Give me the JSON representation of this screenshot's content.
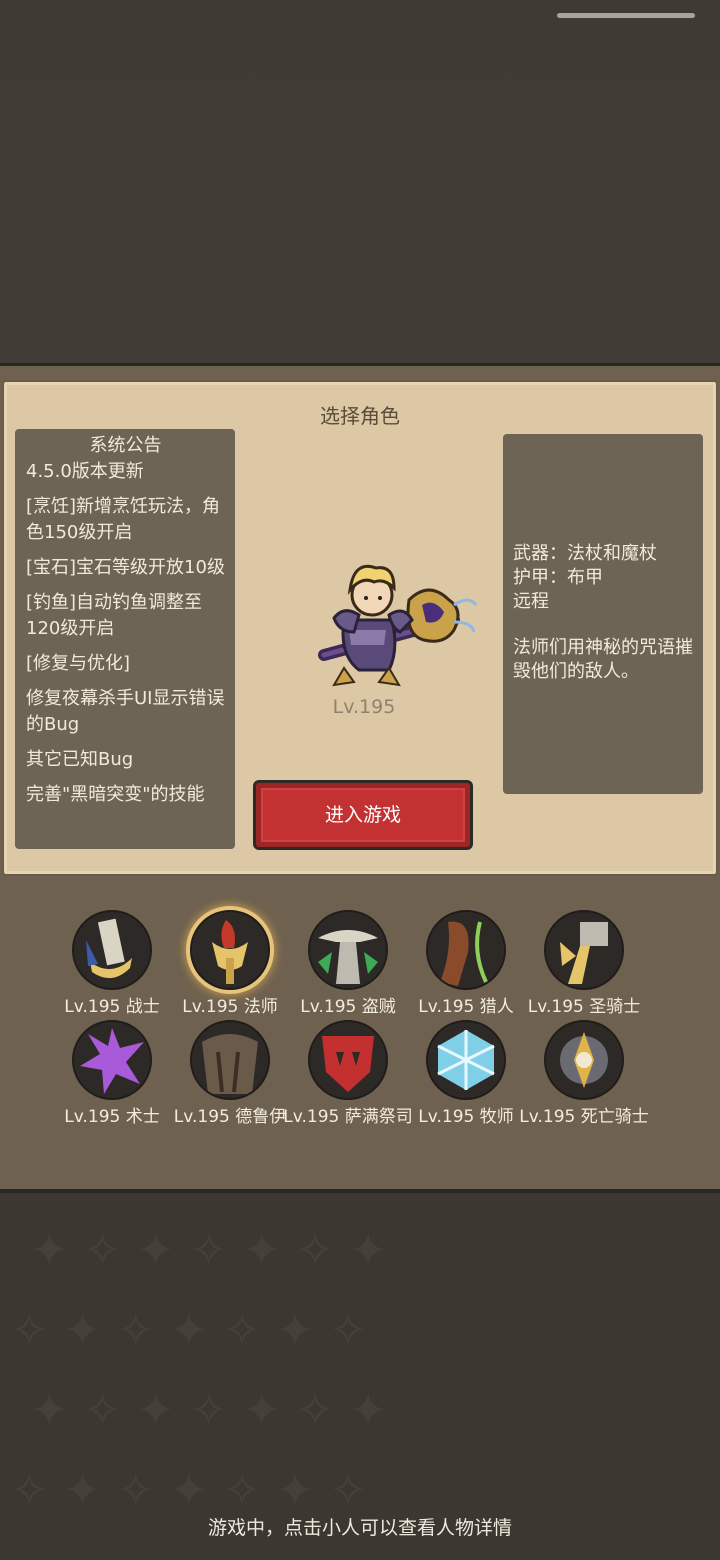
{
  "card": {
    "title": "选择角色"
  },
  "notice": {
    "title": "系统公告",
    "lines": [
      "4.5.0版本更新",
      "[烹饪]新增烹饪玩法，角色150级开启",
      "[宝石]宝石等级开放10级",
      "[钓鱼]自动钓鱼调整至120级开启",
      "[修复与优化]",
      "修复夜幕杀手UI显示错误的Bug",
      "其它已知Bug",
      "完善\"黑暗突变\"的技能"
    ]
  },
  "hero": {
    "level": "Lv.195"
  },
  "enter_button": "进入游戏",
  "info": {
    "weapon": "武器：法杖和魔杖",
    "armor": "护甲：布甲",
    "range": "远程",
    "description": "法师们用神秘的咒语摧毁他们的敌人。"
  },
  "classes": [
    {
      "label": "Lv.195 战士",
      "icon": "warrior-icon",
      "color": "#d9d4c4",
      "selected": false
    },
    {
      "label": "Lv.195 法师",
      "icon": "mage-icon",
      "color": "#c43a2a",
      "selected": true
    },
    {
      "label": "Lv.195 盗贼",
      "icon": "rogue-icon",
      "color": "#3faa55",
      "selected": false
    },
    {
      "label": "Lv.195 猎人",
      "icon": "hunter-icon",
      "color": "#8a4a2c",
      "selected": false
    },
    {
      "label": "Lv.195 圣骑士",
      "icon": "paladin-icon",
      "color": "#e5c46a",
      "selected": false
    },
    {
      "label": "Lv.195 术士",
      "icon": "warlock-icon",
      "color": "#a85ad8",
      "selected": false
    },
    {
      "label": "Lv.195 德鲁伊",
      "icon": "druid-icon",
      "color": "#6a5a4a",
      "selected": false
    },
    {
      "label": "Lv.195 萨满祭司",
      "icon": "shaman-icon",
      "color": "#c43030",
      "selected": false
    },
    {
      "label": "Lv.195 牧师",
      "icon": "priest-icon",
      "color": "#7fd0e6",
      "selected": false
    },
    {
      "label": "Lv.195 死亡骑士",
      "icon": "death-knight-icon",
      "color": "#e0b24a",
      "selected": false
    }
  ],
  "hint": "游戏中，点击小人可以查看人物详情"
}
